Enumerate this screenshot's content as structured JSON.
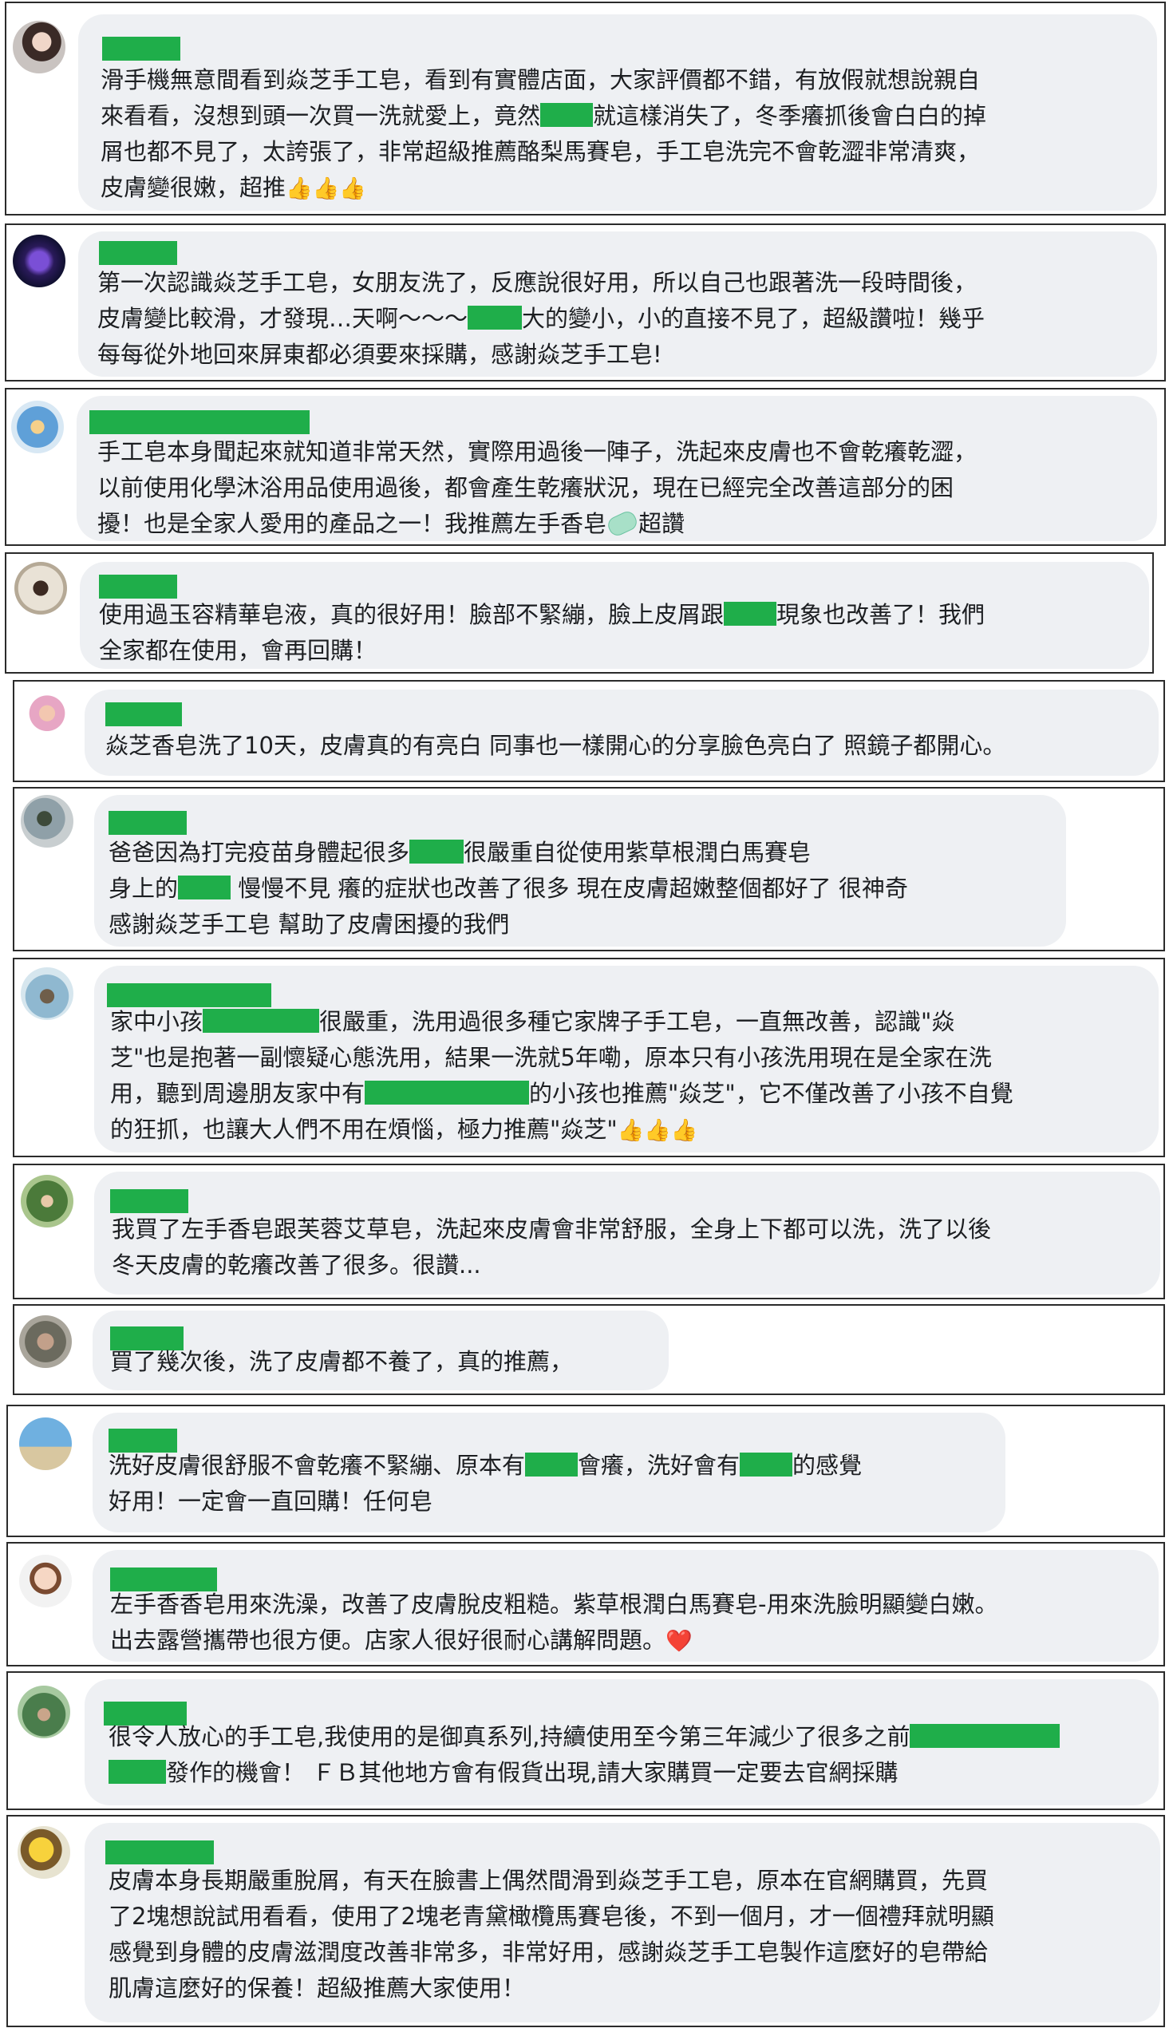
{
  "reviews": [
    {
      "lines": [
        "滑手機無意間看到焱芝手工皂，看到有實體店面，大家評價都不錯，有放假就想說親自",
        "來看看，沒想到頭一次買一洗就愛上，竟然",
        "就這樣消失了，冬季癢抓後會白白的掉",
        "屑也都不見了，太誇張了，非常超級推薦酪梨馬賽皂，手工皂洗完不會乾澀非常清爽，",
        "皮膚變很嫩，超推"
      ],
      "thumbs": "👍👍👍"
    },
    {
      "lines": [
        "第一次認識焱芝手工皂，女朋友洗了，反應說很好用，所以自己也跟著洗一段時間後，",
        "皮膚變比較滑，才發現…天啊～～～",
        "大的變小，小的直接不見了，超級讚啦！幾乎",
        "每每從外地回來屏東都必須要來採購，感謝焱芝手工皂!"
      ]
    },
    {
      "lines": [
        "手工皂本身聞起來就知道非常天然，實際用過後一陣子，洗起來皮膚也不會乾癢乾澀，",
        "以前使用化學沐浴用品使用過後，都會產生乾癢狀況，現在已經完全改善這部分的困",
        "擾！也是全家人愛用的產品之一！我推薦左手香皂",
        "超讚"
      ]
    },
    {
      "lines": [
        "使用過玉容精華皂液，真的很好用！臉部不緊繃，臉上皮屑跟",
        "現象也改善了！我們",
        "全家都在使用，會再回購！"
      ]
    },
    {
      "lines": [
        "焱芝香皂洗了10天，皮膚真的有亮白 同事也一樣開心的分享臉色亮白了 照鏡子都開心。"
      ]
    },
    {
      "lines": [
        "爸爸因為打完疫苗身體起很多",
        "很嚴重自從使用紫草根潤白馬賽皂",
        "身上的",
        " 慢慢不見 癢的症狀也改善了很多 現在皮膚超嫩整個都好了 很神奇",
        "感謝焱芝手工皂 幫助了皮膚困擾的我們"
      ]
    },
    {
      "lines": [
        "家中小孩",
        "很嚴重，洗用過很多種它家牌子手工皂，一直無改善，認識\"焱",
        "芝\"也是抱著一副懷疑心態洗用，結果一洗就5年嘞，原本只有小孩洗用現在是全家在洗",
        "用，聽到周邊朋友家中有",
        "的小孩也推薦\"焱芝\"，它不僅改善了小孩不自覺",
        "的狂抓，也讓大人們不用在煩惱，極力推薦\"焱芝\""
      ],
      "thumbs": "👍👍👍"
    },
    {
      "lines": [
        "我買了左手香皂跟芙蓉艾草皂，洗起來皮膚會非常舒服，全身上下都可以洗，洗了以後",
        "冬天皮膚的乾癢改善了很多。很讚..."
      ]
    },
    {
      "lines": [
        "買了幾次後，洗了皮膚都不養了，真的推薦，"
      ]
    },
    {
      "lines": [
        "洗好皮膚很舒服不會乾癢不緊繃、原本有",
        "會癢，洗好會有",
        "的感覺",
        "好用！一定會一直回購！任何皂"
      ]
    },
    {
      "lines": [
        "左手香香皂用來洗澡，改善了皮膚脫皮粗糙。紫草根潤白馬賽皂-用來洗臉明顯變白嫩。",
        "出去露營攜帶也很方便。店家人很好很耐心講解問題。"
      ],
      "heart": "❤️"
    },
    {
      "lines": [
        "很令人放心的手工皂,我使用的是御真系列,持續使用至今第三年減少了很多之前",
        "發作的機會！ ＦＢ其他地方會有假貨出現,請大家購買一定要去官網採購"
      ]
    },
    {
      "lines": [
        "皮膚本身長期嚴重脫屑，有天在臉書上偶然間滑到焱芝手工皂，原本在官網購買，先買",
        "了2塊想說試用看看，使用了2塊老青黛橄欖馬賽皂後，不到一個月，才一個禮拜就明顯",
        "感覺到身體的皮膚滋潤度改善非常多，非常好用，感謝焱芝手工皂製作這麼好的皂帶給",
        "肌膚這麼好的保養！超級推薦大家使用！"
      ]
    }
  ],
  "colors": {
    "redaction": "#1fae4a",
    "bubble": "#eef0f3",
    "border": "#2b2b2b"
  }
}
